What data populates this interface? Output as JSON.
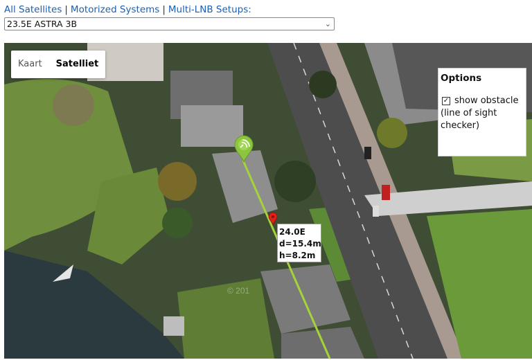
{
  "nav": {
    "all_satellites": "All Satellites",
    "motorized": "Motorized Systems",
    "multi_lnb": "Multi-LNB Setups:",
    "separator": "|"
  },
  "satellite_select": {
    "value": "23.5E ASTRA 3B"
  },
  "map": {
    "map_type": {
      "map_label": "Kaart",
      "satellite_label": "Satelliet",
      "active": "Satelliet"
    },
    "options": {
      "title": "Options",
      "show_obstacle": "show obstacle (line of sight checker)",
      "show_obstacle_checked": true
    },
    "info": {
      "orbit": "24.0E",
      "distance": "d=15.4m",
      "height": "h=8.2m"
    },
    "watermark": "© 201",
    "colors": {
      "sight_line": "#a6d23a",
      "dish_marker": "#8cc63f",
      "obstacle_marker": "#e0201b"
    },
    "icons": {
      "dish_marker": "dish-location-marker-icon",
      "obstacle_marker": "obstacle-pin-icon",
      "checkbox": "checkbox-checked-icon"
    }
  }
}
